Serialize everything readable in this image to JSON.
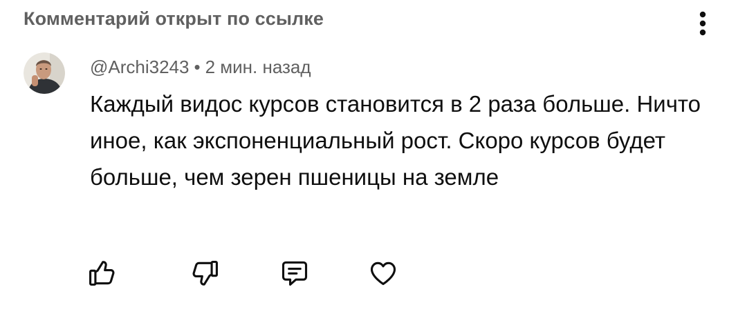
{
  "header": {
    "title": "Комментарий открыт по ссылке",
    "more_icon": "more-vertical-icon"
  },
  "comment": {
    "author": "@Archi3243",
    "separator": "•",
    "time": "2 мин. назад",
    "text": "Каждый видос курсов становится в 2 раза больше. Ничто иное, как экспоненциальный рост. Скоро курсов будет больше, чем зерен пшеницы на земле"
  },
  "actions": [
    {
      "icon": "thumbs-up-icon"
    },
    {
      "icon": "thumbs-down-icon"
    },
    {
      "icon": "reply-icon"
    },
    {
      "icon": "heart-icon"
    }
  ],
  "colors": {
    "text_primary": "#0f0f0f",
    "text_secondary": "#606060",
    "background": "#ffffff"
  }
}
